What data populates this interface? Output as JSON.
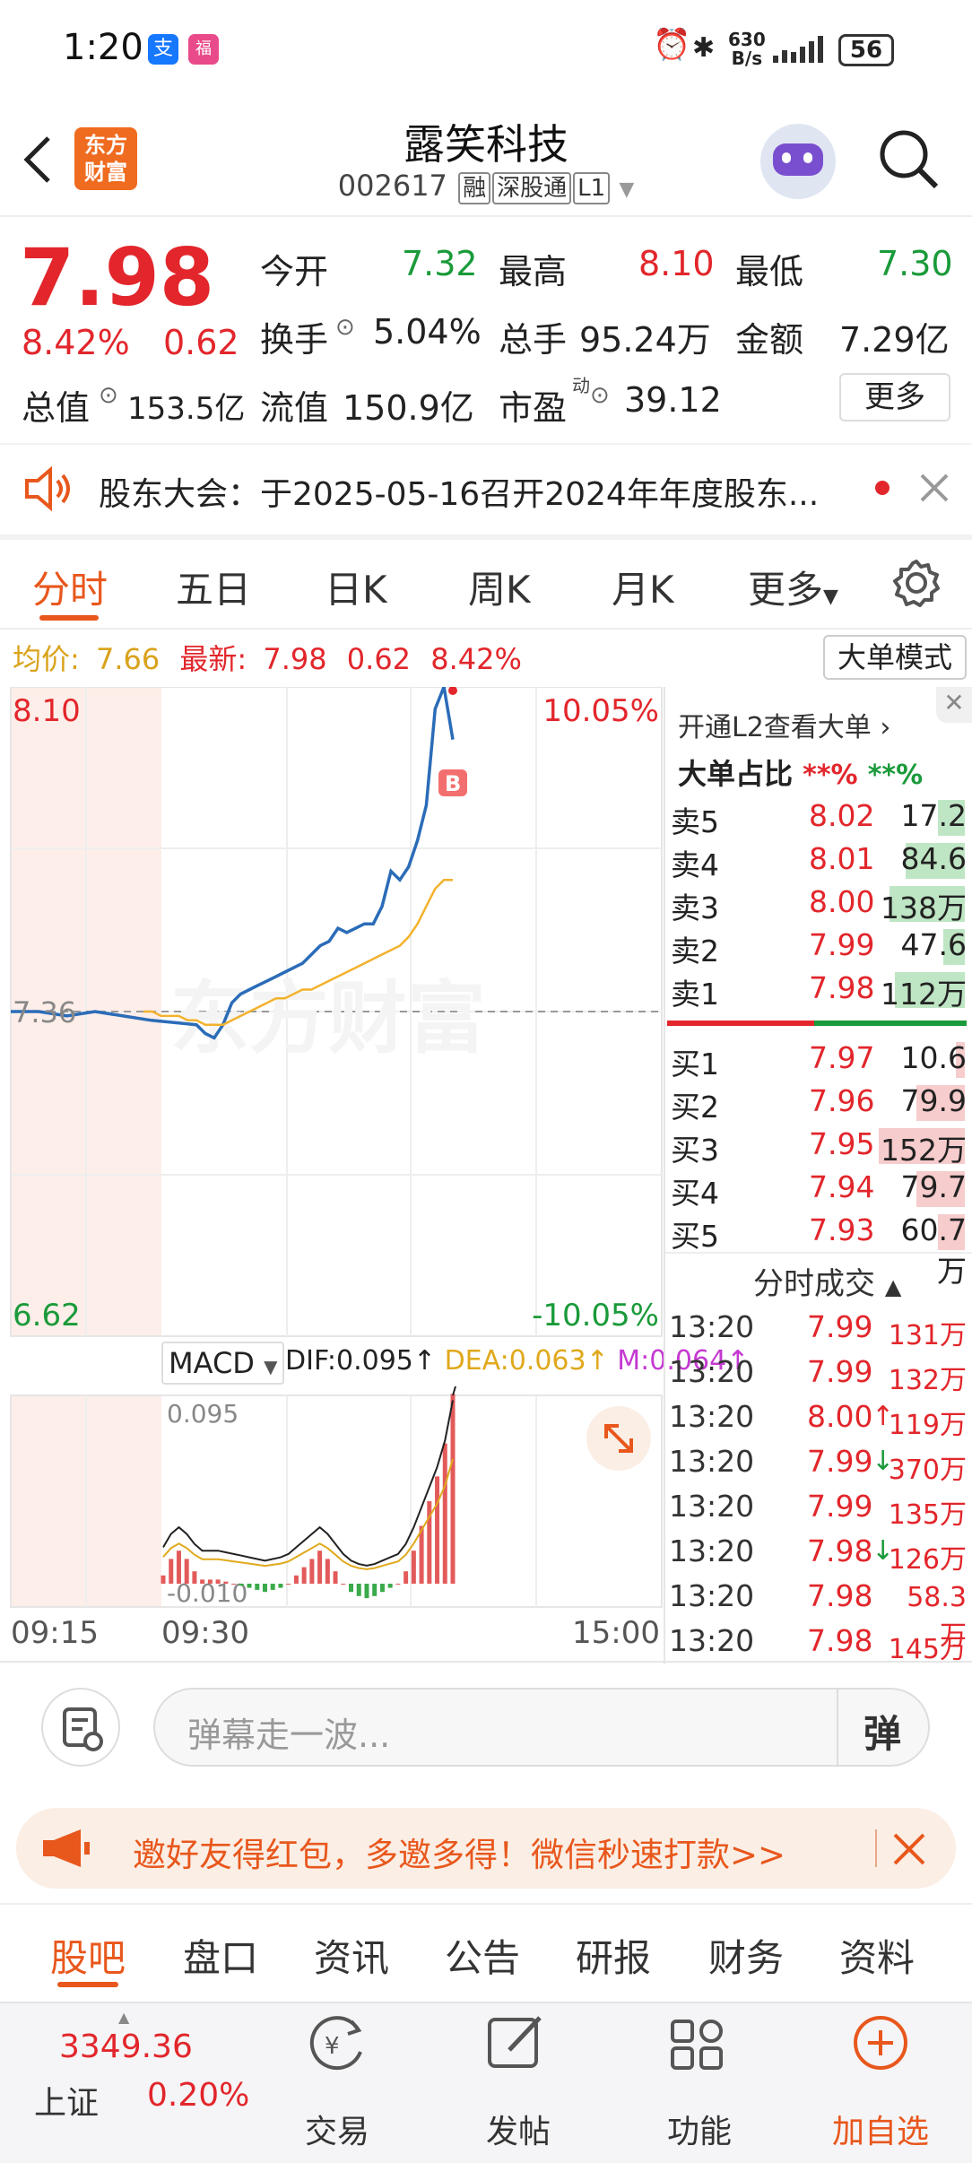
{
  "status_bar": {
    "time": "1:20",
    "app1": "支",
    "app2": "福",
    "net_speed_top": "630",
    "net_speed_bottom": "B/s",
    "battery": "56"
  },
  "header": {
    "title": "露笑科技",
    "code": "002617",
    "tags": [
      "融",
      "深股通",
      "L1"
    ],
    "logo_text": "东方\n财富"
  },
  "quote": {
    "price": "7.98",
    "change_pct": "8.42%",
    "change": "0.62",
    "open_label": "今开",
    "open": "7.32",
    "high_label": "最高",
    "high": "8.10",
    "low_label": "最低",
    "low": "7.30",
    "turnover_label": "换手",
    "turnover": "5.04%",
    "volume_label": "总手",
    "volume": "95.24万",
    "amount_label": "金额",
    "amount": "7.29亿",
    "mktcap_label": "总值",
    "mktcap": "153.5亿",
    "float_label": "流值",
    "float_cap": "150.9亿",
    "pe_label": "市盈",
    "pe_sup": "动",
    "pe": "39.12",
    "more_label": "更多"
  },
  "notice": {
    "text": "股东大会：于2025-05-16召开2024年年度股东..."
  },
  "chart_tabs": [
    "分时",
    "五日",
    "日K",
    "周K",
    "月K",
    "更多"
  ],
  "chart_info": {
    "avg_label": "均价:",
    "avg": "7.66",
    "last_label": "最新:",
    "last": "7.98",
    "chg": "0.62",
    "pct": "8.42%",
    "big_mode": "大单模式"
  },
  "chart_data": {
    "type": "line",
    "title": "",
    "y_labels": {
      "top": "8.10",
      "mid": "7.36",
      "bottom": "6.62",
      "top_pct": "10.05%",
      "bottom_pct": "-10.05%"
    },
    "ylim": [
      6.62,
      8.1
    ],
    "x_labels": [
      "09:15",
      "09:30",
      "15:00"
    ],
    "series": [
      {
        "values": [
          7.36,
          7.36,
          7.35,
          7.36,
          7.35,
          7.34,
          7.33,
          7.31,
          7.3,
          7.33,
          7.38,
          7.4,
          7.41,
          7.42,
          7.43,
          7.44,
          7.45,
          7.46,
          7.47,
          7.49,
          7.51,
          7.52,
          7.55,
          7.54,
          7.55,
          7.56,
          7.56,
          7.6,
          7.68,
          7.66,
          7.69,
          7.75,
          7.83,
          8.05,
          8.1,
          7.98
        ],
        "color": "#2b6cb8"
      },
      {
        "values": [
          7.36,
          7.36,
          7.35,
          7.35,
          7.35,
          7.34,
          7.34,
          7.33,
          7.33,
          7.33,
          7.34,
          7.35,
          7.36,
          7.37,
          7.38,
          7.39,
          7.39,
          7.4,
          7.41,
          7.41,
          7.42,
          7.43,
          7.44,
          7.45,
          7.46,
          7.47,
          7.48,
          7.49,
          7.5,
          7.51,
          7.53,
          7.56,
          7.6,
          7.64,
          7.66,
          7.66
        ],
        "color": "#f2b22d"
      }
    ],
    "marker": "B",
    "watermark": "东方财富"
  },
  "macd": {
    "selector": "MACD",
    "dif": "DIF:0.095",
    "dea": "DEA:0.063",
    "m": "M:0.064",
    "top_label": "0.095",
    "bottom_label": "-0.010",
    "bars": [
      2,
      6,
      8,
      6,
      3,
      1,
      1,
      1,
      0.5,
      0,
      -0.5,
      -1,
      -1.5,
      -2,
      -1.5,
      -1,
      0,
      2,
      4,
      6,
      8,
      6,
      3,
      0,
      -2,
      -3,
      -3.5,
      -3,
      -2,
      -1,
      0,
      3,
      8,
      14,
      20,
      26,
      34,
      46
    ]
  },
  "orderbook": {
    "l2_text": "开通L2查看大单",
    "big_ratio_label": "大单占比",
    "big_red": "**%",
    "big_green": "**%",
    "asks": [
      {
        "label": "卖5",
        "price": "8.02",
        "vol": "17.2万",
        "bar": 0.25
      },
      {
        "label": "卖4",
        "price": "8.01",
        "vol": "84.6万",
        "bar": 0.55
      },
      {
        "label": "卖3",
        "price": "8.00",
        "vol": "138万",
        "bar": 0.7
      },
      {
        "label": "卖2",
        "price": "7.99",
        "vol": "47.6万",
        "bar": 0.2
      },
      {
        "label": "卖1",
        "price": "7.98",
        "vol": "112万",
        "bar": 0.65
      }
    ],
    "bids": [
      {
        "label": "买1",
        "price": "7.97",
        "vol": "10.6万",
        "bar": 0.08
      },
      {
        "label": "买2",
        "price": "7.96",
        "vol": "79.9万",
        "bar": 0.45
      },
      {
        "label": "买3",
        "price": "7.95",
        "vol": "152万",
        "bar": 0.8
      },
      {
        "label": "买4",
        "price": "7.94",
        "vol": "79.7万",
        "bar": 0.45
      },
      {
        "label": "买5",
        "price": "7.93",
        "vol": "60.7万",
        "bar": 0.25
      }
    ],
    "trades_title": "分时成交",
    "trades": [
      {
        "time": "13:20",
        "price": "7.99",
        "vol": "131万",
        "arrow": ""
      },
      {
        "time": "13:20",
        "price": "7.99",
        "vol": "132万",
        "arrow": ""
      },
      {
        "time": "13:20",
        "price": "8.00",
        "vol": "119万",
        "arrow": "↑"
      },
      {
        "time": "13:20",
        "price": "7.99",
        "vol": "370万",
        "arrow": "↓"
      },
      {
        "time": "13:20",
        "price": "7.99",
        "vol": "135万",
        "arrow": ""
      },
      {
        "time": "13:20",
        "price": "7.98",
        "vol": "126万",
        "arrow": "↓"
      },
      {
        "time": "13:20",
        "price": "7.98",
        "vol": "58.3万",
        "arrow": ""
      },
      {
        "time": "13:20",
        "price": "7.98",
        "vol": "145万",
        "arrow": ""
      }
    ]
  },
  "danmu": {
    "placeholder": "弹幕走一波...",
    "send": "弹"
  },
  "promo": {
    "text": "邀好友得红包，多邀多得！微信秒速打款>>"
  },
  "sub_tabs": [
    "股吧",
    "盘口",
    "资讯",
    "公告",
    "研报",
    "财务",
    "资料"
  ],
  "bottom_nav": {
    "index_value": "3349.36",
    "index_name": "上证",
    "index_pct": "0.20%",
    "items": [
      {
        "label": "交易",
        "icon": "trade-icon"
      },
      {
        "label": "发帖",
        "icon": "post-icon"
      },
      {
        "label": "功能",
        "icon": "apps-icon"
      },
      {
        "label": "加自选",
        "icon": "add-watch-icon"
      }
    ]
  },
  "colors": {
    "up": "#e2262b",
    "down": "#1a9a3a",
    "accent": "#e8571c",
    "line": "#2b6cb8",
    "avg": "#f2b22d"
  }
}
